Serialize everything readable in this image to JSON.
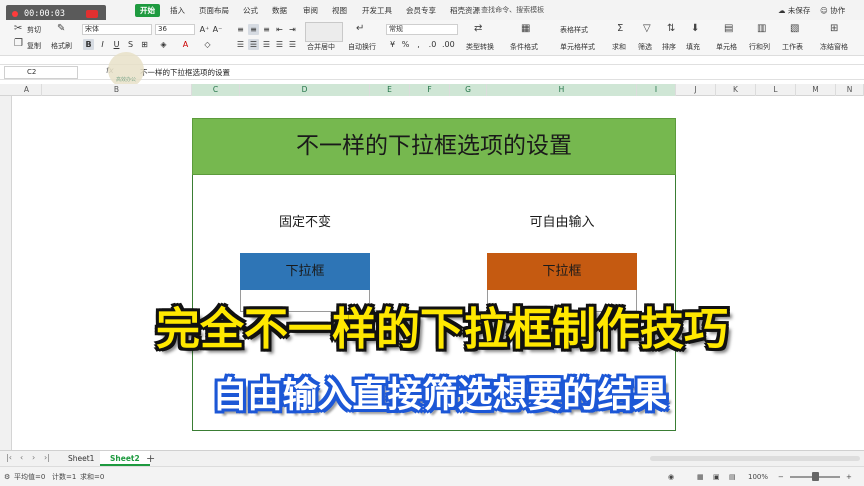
{
  "recording": {
    "time": "00:00:03"
  },
  "menubar": {
    "tabs": [
      "开始",
      "插入",
      "页面布局",
      "公式",
      "数据",
      "审阅",
      "视图",
      "开发工具",
      "会员专享",
      "稻壳资源"
    ],
    "active_tab": "开始",
    "search": "查找命令、搜索模板",
    "right": [
      "未保存",
      "协作"
    ]
  },
  "ribbon": {
    "cut": "剪切",
    "copy": "复制",
    "format_painter": "格式刷",
    "font_name": "宋体",
    "font_size": "36",
    "merge_center": "合并居中",
    "auto_wrap": "自动换行",
    "number_format": "常规",
    "type_convert": "类型转换",
    "conditional_format": "条件格式",
    "table_style": "表格样式",
    "cell_style": "单元格样式",
    "sum": "求和",
    "filter": "筛选",
    "sort": "排序",
    "fill": "填充",
    "cells": "单元格",
    "rows_cols": "行和列",
    "worksheet": "工作表",
    "freeze": "冻结窗格"
  },
  "formula_bar": {
    "cell_ref": "C2",
    "fx": "fx",
    "content": "不一样的下拉框选项的设置"
  },
  "watermark": {
    "text": "高效办公"
  },
  "columns": [
    "A",
    "B",
    "C",
    "D",
    "E",
    "F",
    "G",
    "H",
    "I",
    "J",
    "K",
    "L",
    "M",
    "N"
  ],
  "sheet": {
    "title": "不一样的下拉框选项的设置",
    "left_label": "固定不变",
    "right_label": "可自由输入",
    "left_dropdown": "下拉框",
    "right_dropdown": "下拉框",
    "colors": {
      "title_bg": "#76b84f",
      "left_bg": "#2e75b6",
      "right_bg": "#c55a11"
    }
  },
  "overlay": {
    "main_caption": "完全不一样的下拉框制作技巧",
    "sub_caption": "自由输入直接筛选想要的结果"
  },
  "sheet_tabs": {
    "tabs": [
      "Sheet1",
      "Sheet2"
    ],
    "active": "Sheet2"
  },
  "status_bar": {
    "average": "平均值=0",
    "count": "计数=1",
    "sum": "求和=0",
    "zoom": "100%"
  }
}
